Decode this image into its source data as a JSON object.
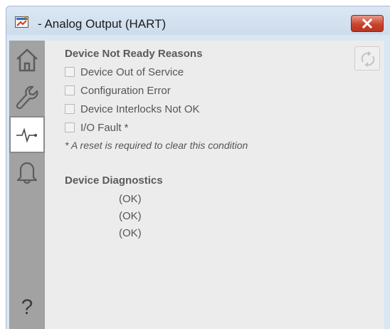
{
  "window": {
    "title": "- Analog Output (HART)"
  },
  "sidebar": {
    "items": [
      {
        "icon": "home-icon"
      },
      {
        "icon": "wrench-icon"
      },
      {
        "icon": "pulse-icon",
        "active": true
      },
      {
        "icon": "bell-icon"
      }
    ],
    "help_label": "?"
  },
  "reasons": {
    "title": "Device Not Ready Reasons",
    "items": [
      {
        "label": "Device Out of Service",
        "checked": false
      },
      {
        "label": "Configuration Error",
        "checked": false
      },
      {
        "label": "Device Interlocks Not OK",
        "checked": false
      },
      {
        "label": "I/O Fault *",
        "checked": false
      }
    ],
    "note": "* A reset is required to clear this condition"
  },
  "diagnostics": {
    "title": "Device Diagnostics",
    "values": [
      "(OK)",
      "(OK)",
      "(OK)"
    ]
  },
  "colors": {
    "sidebar": "#a2a2a2",
    "content_bg": "#ececec",
    "close_button": "#c8432c"
  }
}
